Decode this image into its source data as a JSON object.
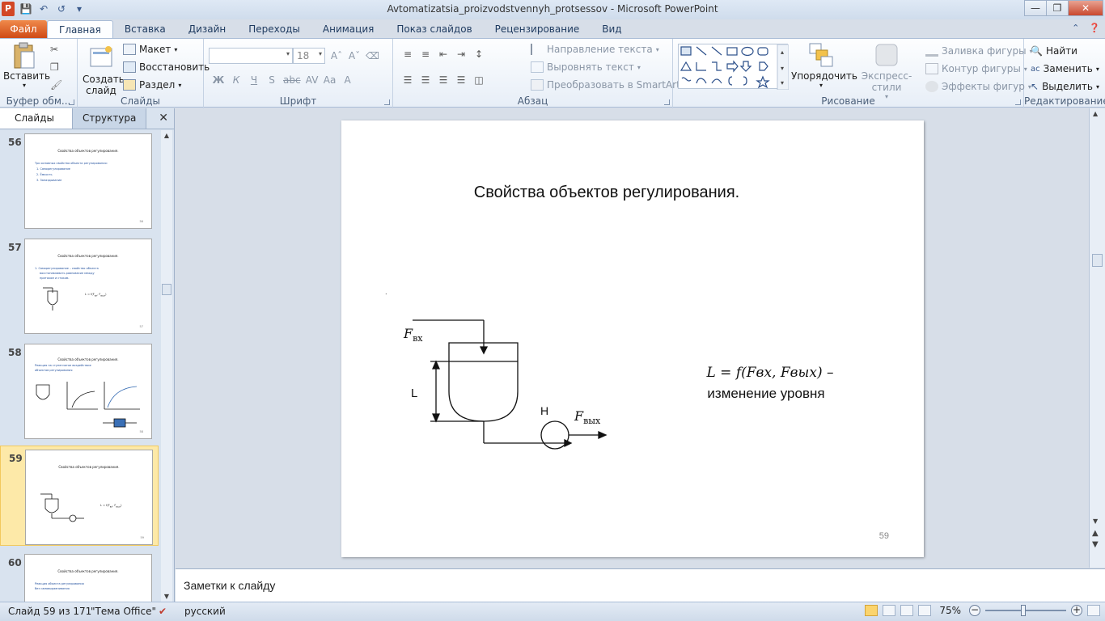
{
  "window": {
    "title": "Avtomatizatsia_proizvodstvennyh_protsessov  -  Microsoft PowerPoint"
  },
  "tabs": {
    "file": "Файл",
    "items": [
      "Главная",
      "Вставка",
      "Дизайн",
      "Переходы",
      "Анимация",
      "Показ слайдов",
      "Рецензирование",
      "Вид"
    ]
  },
  "ribbon": {
    "clipboard": {
      "paste": "Вставить",
      "label": "Буфер обм..."
    },
    "slides": {
      "new_slide": "Создать слайд",
      "layout": "Макет",
      "reset": "Восстановить",
      "section": "Раздел",
      "label": "Слайды"
    },
    "font": {
      "font_name": "",
      "font_size": "18",
      "label": "Шрифт",
      "buttons": [
        "Ж",
        "К",
        "Ч",
        "S",
        "abc",
        "AV",
        "Aa",
        "A"
      ]
    },
    "paragraph": {
      "text_direction": "Направление текста",
      "align_text": "Выровнять текст",
      "smartart": "Преобразовать в SmartArt",
      "label": "Абзац"
    },
    "drawing": {
      "arrange": "Упорядочить",
      "quick_styles": "Экспресс-стили",
      "fill": "Заливка фигуры",
      "outline": "Контур фигуры",
      "effects": "Эффекты фигур",
      "label": "Рисование"
    },
    "editing": {
      "find": "Найти",
      "replace": "Заменить",
      "select": "Выделить",
      "label": "Редактирование"
    }
  },
  "left_panel": {
    "tabs": [
      "Слайды",
      "Структура"
    ],
    "thumbnails": [
      {
        "num": "56",
        "title": "Свойства объектов регулирования.",
        "lines": [
          "Три основных свойства объекта регулирования:",
          "1. Саморегулирование",
          "2. Ёмкость",
          "3. Запаздывание"
        ],
        "page": "56"
      },
      {
        "num": "57",
        "title": "Свойства объектов регулирования.",
        "lines": [
          "1. Саморегулирование – свойство объекта",
          "восстанавливать равновесие между",
          "притоком и стоком."
        ],
        "page": "57"
      },
      {
        "num": "58",
        "title": "Свойства объектов регулирования.",
        "lines": [
          "Реакция на ступенчатое воздействие",
          "объектов регулирования"
        ],
        "page": "58"
      },
      {
        "num": "59",
        "title": "Свойства объектов регулирования.",
        "lines": [],
        "page": "59"
      },
      {
        "num": "60",
        "title": "Свойства объектов регулирования.",
        "lines": [
          "Реакция объекта регулирования",
          "без самовыравнивания"
        ],
        "page": "60"
      }
    ],
    "selected": "59"
  },
  "slide": {
    "title": "Свойства объектов регулирования.",
    "label_fin": "F",
    "label_fin_sub": "вх",
    "label_fout": "F",
    "label_fout_sub": "вых",
    "label_L": "L",
    "label_H": "H",
    "formula": "L = f(Fвх, Fвых) –",
    "formula_caption": "изменение уровня",
    "page_number": "59"
  },
  "notes": {
    "placeholder": "Заметки к слайду"
  },
  "status": {
    "slide_info": "Слайд 59 из 171",
    "theme": "\"Тема Office\"",
    "language": "русский",
    "zoom": "75%"
  }
}
